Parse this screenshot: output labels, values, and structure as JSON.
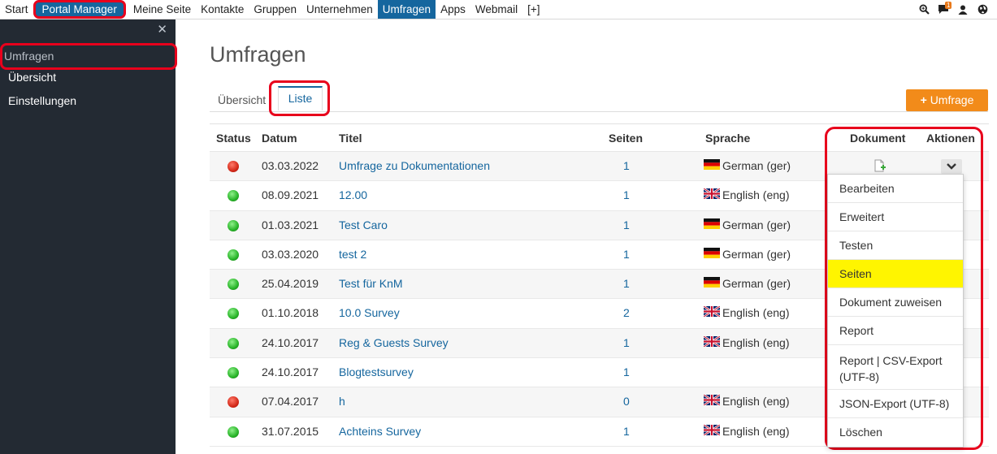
{
  "topnav": {
    "items": [
      "Start",
      "Portal Manager",
      "Meine Seite",
      "Kontakte",
      "Gruppen",
      "Unternehmen",
      "Umfragen",
      "Apps",
      "Webmail",
      "[+]"
    ],
    "notification_count": "1",
    "icons": [
      "search-icon",
      "chat-icon",
      "user-icon",
      "globe-icon"
    ]
  },
  "sidebar": {
    "close_glyph": "✕",
    "section_title": "Umfragen",
    "items": [
      "Übersicht",
      "Einstellungen"
    ]
  },
  "main": {
    "title": "Umfragen",
    "tabs": [
      "Übersicht",
      "Liste"
    ],
    "add_button_label": "Umfrage",
    "add_button_icon": "+"
  },
  "table": {
    "headers": [
      "Status",
      "Datum",
      "Titel",
      "Seiten",
      "Sprache",
      "Dokument",
      "Aktionen"
    ],
    "rows": [
      {
        "status": "red",
        "date": "03.03.2022",
        "title": "Umfrage zu Dokumentationen",
        "pages": "1",
        "language": "German (ger)",
        "flag": "de"
      },
      {
        "status": "green",
        "date": "08.09.2021",
        "title": "12.00",
        "pages": "1",
        "language": "English (eng)",
        "flag": "gb"
      },
      {
        "status": "green",
        "date": "01.03.2021",
        "title": "Test Caro",
        "pages": "1",
        "language": "German (ger)",
        "flag": "de"
      },
      {
        "status": "green",
        "date": "03.03.2020",
        "title": "test 2",
        "pages": "1",
        "language": "German (ger)",
        "flag": "de"
      },
      {
        "status": "green",
        "date": "25.04.2019",
        "title": "Test für KnM",
        "pages": "1",
        "language": "German (ger)",
        "flag": "de"
      },
      {
        "status": "green",
        "date": "01.10.2018",
        "title": "10.0 Survey",
        "pages": "2",
        "language": "English (eng)",
        "flag": "gb"
      },
      {
        "status": "green",
        "date": "24.10.2017",
        "title": "Reg & Guests Survey",
        "pages": "1",
        "language": "English (eng)",
        "flag": "gb"
      },
      {
        "status": "green",
        "date": "24.10.2017",
        "title": "Blogtestsurvey",
        "pages": "1",
        "language": "",
        "flag": ""
      },
      {
        "status": "red",
        "date": "07.04.2017",
        "title": "h",
        "pages": "0",
        "language": "English (eng)",
        "flag": "gb"
      },
      {
        "status": "green",
        "date": "31.07.2015",
        "title": "Achteins Survey",
        "pages": "1",
        "language": "English (eng)",
        "flag": "gb"
      }
    ]
  },
  "dropdown": {
    "items": [
      "Bearbeiten",
      "Erweitert",
      "Testen",
      "Seiten",
      "Dokument zuweisen",
      "Report",
      "Report | CSV-Export (UTF-8)",
      "JSON-Export (UTF-8)",
      "Löschen"
    ],
    "highlighted": "Seiten"
  },
  "colors": {
    "brand_blue": "#15669e",
    "sidebar_bg": "#232a33",
    "add_button": "#f28b1a",
    "annotation_red": "#e8001c",
    "highlight_yellow": "#fff500"
  }
}
